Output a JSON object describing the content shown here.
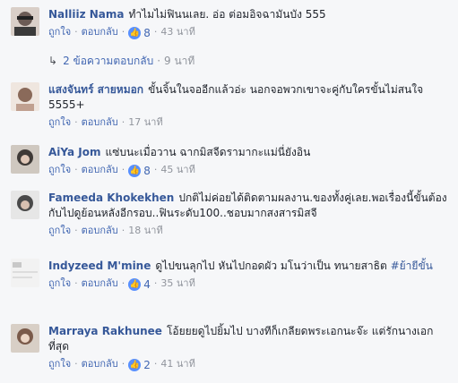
{
  "actions": {
    "like": "ถูกใจ",
    "reply": "ตอบกลับ",
    "separator": "·"
  },
  "comments": [
    {
      "name": "Nalliiz Nama",
      "text": "ทำไมไม่ฟินนเลย. อ่อ ต่อมอิจฉามันบัง 555",
      "likes": "8",
      "time": "43 นาที",
      "avatar_color": "#6b5b55"
    },
    {
      "name": "แสงจันทร์ สายหมอก",
      "text": "ขั้นจิ้นในจออีกแล้วอ่ะ นอกจอพวกเขาจะคู่กับใครขั้นไม่สนใจ 5555+",
      "likes": "",
      "time": "17 นาที",
      "avatar_color": "#8a6a5a"
    },
    {
      "name": "AiYa Jom",
      "text": "แซ่บนะเมื่อวาน ฉากมิสจีดรามากะแม่นี่ยังอิน",
      "likes": "8",
      "time": "45 นาที",
      "avatar_color": "#3f3a37"
    },
    {
      "name": "Fameeda Khokekhen",
      "text": "ปกติไม่ค่อยได้ติดตามผลงาน.ของทั้งคู่เลย.พอเรื่องนี้ขั้นต้องกับไปดูย้อนหลังอีกรอบ..ฟินระดับ100..ชอบมากสงสารมิสจี",
      "likes": "",
      "time": "18 นาที",
      "avatar_color": "#4a4a4a"
    },
    {
      "name": "Indyzeed M'mine",
      "text": "ดูไปขนลุกไป หันไปกอดผัว มโนว่าเป็น ทนายสาธิต",
      "hashtag": "#ย้ายีขั้น",
      "likes": "4",
      "time": "35 นาที",
      "avatar_color": "#e8e8e8"
    },
    {
      "name": "Marraya Rakhunee",
      "text": "โอ้ยยยดูไปยิ้มไป บางทีก็เกลียดพระเอกนะจ๊ะ แต่รักนางเอกที่สุด",
      "likes": "2",
      "time": "41 นาที",
      "avatar_color": "#7a5a4a"
    }
  ],
  "reply_summary": {
    "label": "2 ข้อความตอบกลับ",
    "time": "9 นาที"
  }
}
